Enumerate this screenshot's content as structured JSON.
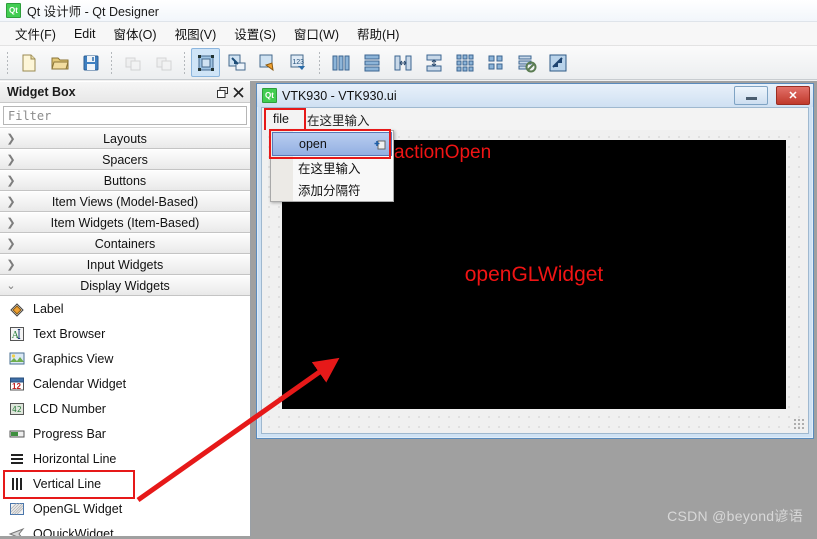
{
  "window": {
    "app_icon": "qt-logo-icon",
    "title": "Qt 设计师 - Qt Designer"
  },
  "menubar": {
    "items": [
      {
        "label": "文件(F)",
        "mnemonic": "F"
      },
      {
        "label": "Edit",
        "mnemonic": "E"
      },
      {
        "label": "窗体(O)",
        "mnemonic": "O"
      },
      {
        "label": "视图(V)",
        "mnemonic": "V"
      },
      {
        "label": "设置(S)",
        "mnemonic": "S"
      },
      {
        "label": "窗口(W)",
        "mnemonic": "W"
      },
      {
        "label": "帮助(H)",
        "mnemonic": "H"
      }
    ]
  },
  "toolbar": {
    "groups": [
      {
        "buttons": [
          {
            "name": "new-form-icon",
            "label": "New",
            "enabled": true,
            "active": false
          },
          {
            "name": "open-form-icon",
            "label": "Open",
            "enabled": true,
            "active": false
          },
          {
            "name": "save-form-icon",
            "label": "Save",
            "enabled": true,
            "active": false
          }
        ]
      },
      {
        "buttons": [
          {
            "name": "undo-icon",
            "label": "Undo",
            "enabled": false,
            "active": false
          },
          {
            "name": "redo-icon",
            "label": "Redo",
            "enabled": false,
            "active": false
          }
        ]
      },
      {
        "buttons": [
          {
            "name": "edit-widgets-icon",
            "label": "Edit Widgets",
            "enabled": true,
            "active": true
          },
          {
            "name": "edit-signals-slots-icon",
            "label": "Edit Signals/Slots",
            "enabled": true,
            "active": false
          },
          {
            "name": "edit-buddies-icon",
            "label": "Edit Buddies",
            "enabled": true,
            "active": false
          },
          {
            "name": "edit-tab-order-icon",
            "label": "Edit Tab Order",
            "enabled": true,
            "active": false
          }
        ]
      },
      {
        "buttons": [
          {
            "name": "layout-horizontally-icon",
            "label": "Lay Out Horizontally",
            "enabled": true,
            "active": false
          },
          {
            "name": "layout-vertically-icon",
            "label": "Lay Out Vertically",
            "enabled": true,
            "active": false
          },
          {
            "name": "layout-splitter-horizontal-icon",
            "label": "Lay Out in a Horizontal Splitter",
            "enabled": true,
            "active": false
          },
          {
            "name": "layout-splitter-vertical-icon",
            "label": "Lay Out in a Vertical Splitter",
            "enabled": true,
            "active": false
          },
          {
            "name": "layout-grid-icon",
            "label": "Lay Out in a Grid",
            "enabled": true,
            "active": false
          },
          {
            "name": "layout-form-icon",
            "label": "Lay Out in a Form Layout",
            "enabled": true,
            "active": false
          },
          {
            "name": "break-layout-icon",
            "label": "Break Layout",
            "enabled": true,
            "active": false
          },
          {
            "name": "adjust-size-icon",
            "label": "Adjust Size",
            "enabled": true,
            "active": false
          }
        ]
      }
    ]
  },
  "widget_box": {
    "title": "Widget Box",
    "float_icon": "undock-icon",
    "close_icon": "close-icon",
    "filter": {
      "value": "",
      "placeholder": "Filter"
    },
    "categories": [
      {
        "label": "Layouts",
        "expanded": false
      },
      {
        "label": "Spacers",
        "expanded": false
      },
      {
        "label": "Buttons",
        "expanded": false
      },
      {
        "label": "Item Views (Model-Based)",
        "expanded": false
      },
      {
        "label": "Item Widgets (Item-Based)",
        "expanded": false
      },
      {
        "label": "Containers",
        "expanded": false
      },
      {
        "label": "Input Widgets",
        "expanded": false
      },
      {
        "label": "Display Widgets",
        "expanded": true
      }
    ],
    "items": [
      {
        "label": "Label",
        "icon": "label-icon",
        "highlighted": false
      },
      {
        "label": "Text Browser",
        "icon": "text-browser-icon",
        "highlighted": false
      },
      {
        "label": "Graphics View",
        "icon": "graphics-view-icon",
        "highlighted": false
      },
      {
        "label": "Calendar Widget",
        "icon": "calendar-widget-icon",
        "highlighted": false
      },
      {
        "label": "LCD Number",
        "icon": "lcd-number-icon",
        "highlighted": false
      },
      {
        "label": "Progress Bar",
        "icon": "progress-bar-icon",
        "highlighted": false
      },
      {
        "label": "Horizontal Line",
        "icon": "horizontal-line-icon",
        "highlighted": false
      },
      {
        "label": "Vertical Line",
        "icon": "vertical-line-icon",
        "highlighted": false
      },
      {
        "label": "OpenGL Widget",
        "icon": "opengl-widget-icon",
        "highlighted": true
      },
      {
        "label": "QQuickWidget",
        "icon": "qquickwidget-icon",
        "highlighted": false
      }
    ]
  },
  "form_window": {
    "icon": "qt-logo-icon",
    "title": "VTK930 - VTK930.ui",
    "minimize_label": "minimize-icon",
    "close_label": "✕",
    "menubar": [
      {
        "label": "file",
        "highlighted": true
      },
      {
        "label": "在这里输入",
        "highlighted": false
      }
    ],
    "dropdown": {
      "items": [
        {
          "label": "open",
          "selected": true,
          "badge": "action-badge-icon"
        },
        {
          "label": "在这里输入",
          "selected": false,
          "badge": ""
        },
        {
          "label": "添加分隔符",
          "selected": false,
          "badge": ""
        }
      ]
    },
    "central_widget": {
      "label": "openGLWidget",
      "background": "#000000",
      "text_color": "#f01414"
    }
  },
  "annotations": {
    "action_open_label": "actionOpen",
    "accent_color": "#e61919",
    "arrow": {
      "from": [
        138,
        378
      ],
      "to": [
        338,
        358
      ]
    }
  },
  "watermark": {
    "text": "CSDN @beyond谚语"
  }
}
